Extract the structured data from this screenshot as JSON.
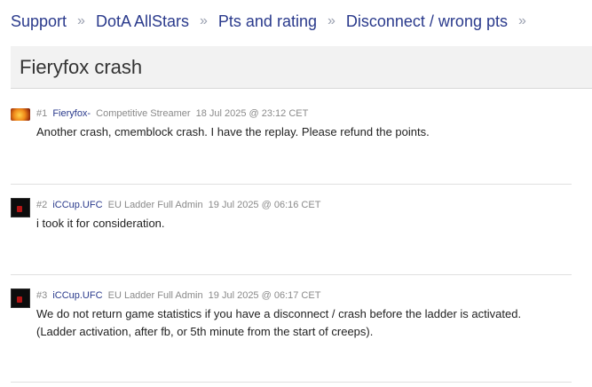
{
  "breadcrumb": [
    {
      "label": "Support"
    },
    {
      "label": "DotA AllStars"
    },
    {
      "label": "Pts and rating"
    },
    {
      "label": "Disconnect / wrong pts"
    }
  ],
  "breadcrumb_separator": "»",
  "thread": {
    "title": "Fieryfox crash"
  },
  "posts": [
    {
      "number": "#1",
      "user": "Fieryfox-",
      "rank": "Competitive Streamer",
      "date": "18 Jul 2025 @ 23:12 CET",
      "avatar": "fire-avatar-icon",
      "lines": [
        "Another crash, cmemblock crash. I have the replay. Please refund the points."
      ]
    },
    {
      "number": "#2",
      "user": "iCCup.UFC",
      "rank": "EU Ladder Full Admin",
      "date": "19 Jul 2025 @ 06:16 CET",
      "avatar": "dark-admin-avatar-icon",
      "lines": [
        "i took it for consideration."
      ]
    },
    {
      "number": "#3",
      "user": "iCCup.UFC",
      "rank": "EU Ladder Full Admin",
      "date": "19 Jul 2025 @ 06:17 CET",
      "avatar": "dark-admin-avatar-icon",
      "lines": [
        "We do not return game statistics if you have a disconnect / crash before the ladder is activated.",
        "(Ladder activation, after fb, or 5th minute from the start of creeps)."
      ]
    }
  ],
  "colors": {
    "link": "#2a3a8c",
    "muted": "#8a8a8a",
    "title_bar": "#f2f2f2"
  }
}
